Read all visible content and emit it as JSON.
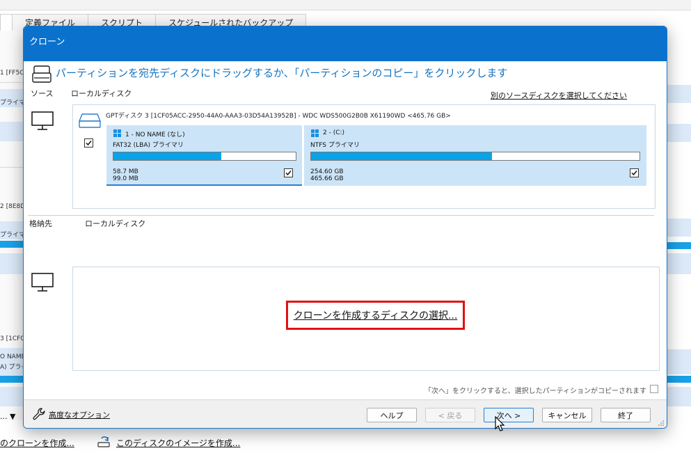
{
  "background": {
    "tabs": [
      "",
      "定義ファイル",
      "スクリプト",
      "スケジュールされたバックアップ"
    ],
    "left_fragments": [
      "1 [FF5C",
      "プライマリ",
      "2 [8E8D",
      "プライマリ",
      "3 [1CF0",
      "O NAME",
      "A) プライ"
    ],
    "combo_fragment": "...",
    "bottom_links": [
      "のクローンを作成...",
      "このディスクのイメージを作成..."
    ]
  },
  "dialog": {
    "title": "クローン",
    "instruction": "パーティションを宛先ディスクにドラッグするか、「パーティションのコピー」をクリックします",
    "source": {
      "label": "ソース",
      "disk_label": "ローカルディスク",
      "select_other": "別のソースディスクを選択してください",
      "disk_info": "GPTディスク 3 [1CF05ACC-2950-44A0-AAA3-03D54A13952B] - WDC WDS500G2B0B X61190WD  <465.76 GB>",
      "checked": true,
      "partitions": [
        {
          "name": "1 - NO NAME (なし)",
          "type": "FAT32 (LBA) プライマリ",
          "used": "58.7 MB",
          "total": "99.0 MB",
          "fill": 0.59,
          "checked": true
        },
        {
          "name": "2 -  (C:)",
          "type": "NTFS プライマリ",
          "used": "254.60 GB",
          "total": "465.66 GB",
          "fill": 0.55,
          "checked": true
        }
      ]
    },
    "destination": {
      "label": "格納先",
      "disk_label": "ローカルディスク",
      "select_link": "クローンを作成するディスクの選択..."
    },
    "hint": "「次へ」をクリックすると、選択したパーティションがコピーされます",
    "footer": {
      "advanced": "高度なオプション",
      "help": "ヘルプ",
      "back": "< 戻る",
      "next": "次へ >",
      "cancel": "キャンセル",
      "finish": "終了"
    }
  },
  "colors": {
    "titlebar": "#0a72cc",
    "instruction": "#1574c0",
    "partition_bg": "#cce4f7",
    "bar_fill": "#0aa3e8",
    "highlight": "#e31010"
  }
}
